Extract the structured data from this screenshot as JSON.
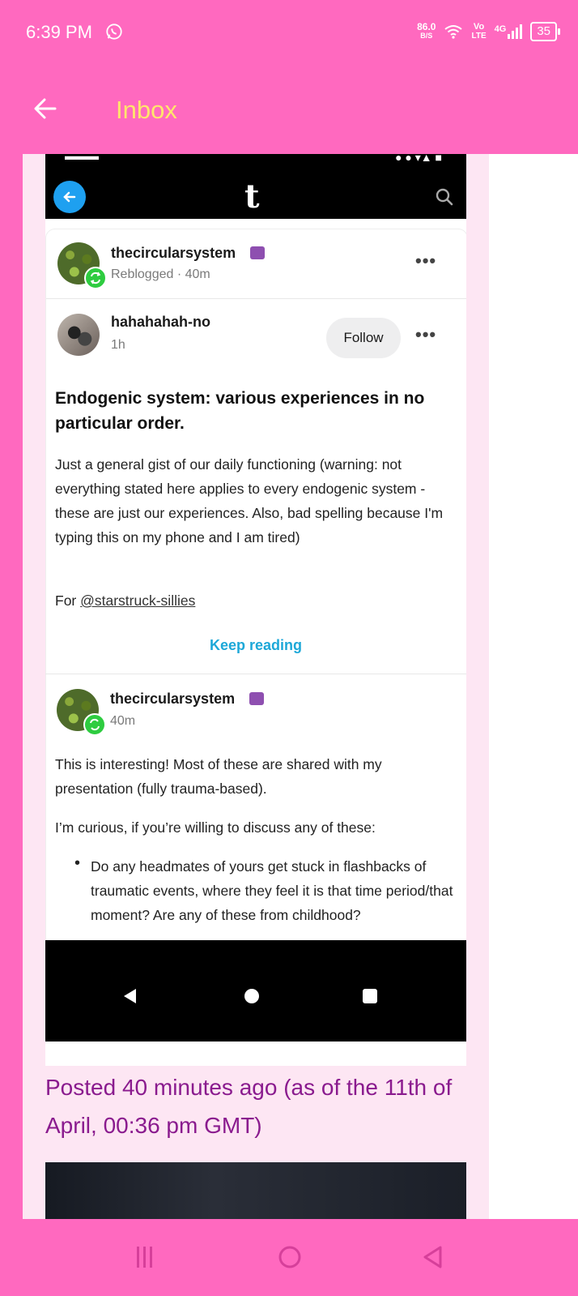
{
  "status_bar": {
    "time": "6:39 PM",
    "net_speed_value": "86.0",
    "net_speed_unit": "B/S",
    "volte_top": "Vo",
    "volte_bottom": "LTE",
    "network": "4G",
    "battery": "35",
    "icons": [
      "whatsapp-icon",
      "wifi-icon",
      "signal-icon",
      "battery-icon"
    ]
  },
  "app_bar": {
    "title": "Inbox",
    "back_icon": "arrow-left-icon",
    "title_color": "#ffe66b",
    "background": "#ff69bf"
  },
  "embedded_screenshot": {
    "header": {
      "logo": "t",
      "back_icon": "arrow-left-icon",
      "search_icon": "search-icon"
    },
    "reblogger": {
      "username": "thecircularsystem",
      "meta": "Reblogged · 40m"
    },
    "original_post": {
      "username": "hahahahah-no",
      "time": "1h",
      "follow_label": "Follow",
      "title": "Endogenic system: various experiences in no particular order.",
      "body": "Just a general gist of our daily functioning (warning: not everything stated here applies to every endogenic system - these are just our experiences. Also, bad spelling because I'm typing this on my phone and I am tired)",
      "for_prefix": "For ",
      "mention": "@starstruck-sillies",
      "keep_reading": "Keep reading"
    },
    "reblog_comment": {
      "username": "thecircularsystem",
      "time": "40m",
      "paragraph1": "This is interesting! Most of these are shared with my presentation (fully trauma-based).",
      "paragraph2": "I’m curious, if you’re willing to discuss any of these:",
      "bullet1": "Do any headmates of yours get stuck in flashbacks of traumatic events, where they feel it is that time period/that moment? Are any of these from childhood?"
    }
  },
  "caption": "Posted 40 minutes ago (as of the 11th of April, 00:36 pm GMT)",
  "nav_bar": {
    "recents_icon": "recents-icon",
    "home_icon": "home-circle-icon",
    "back_icon": "back-triangle-icon"
  }
}
